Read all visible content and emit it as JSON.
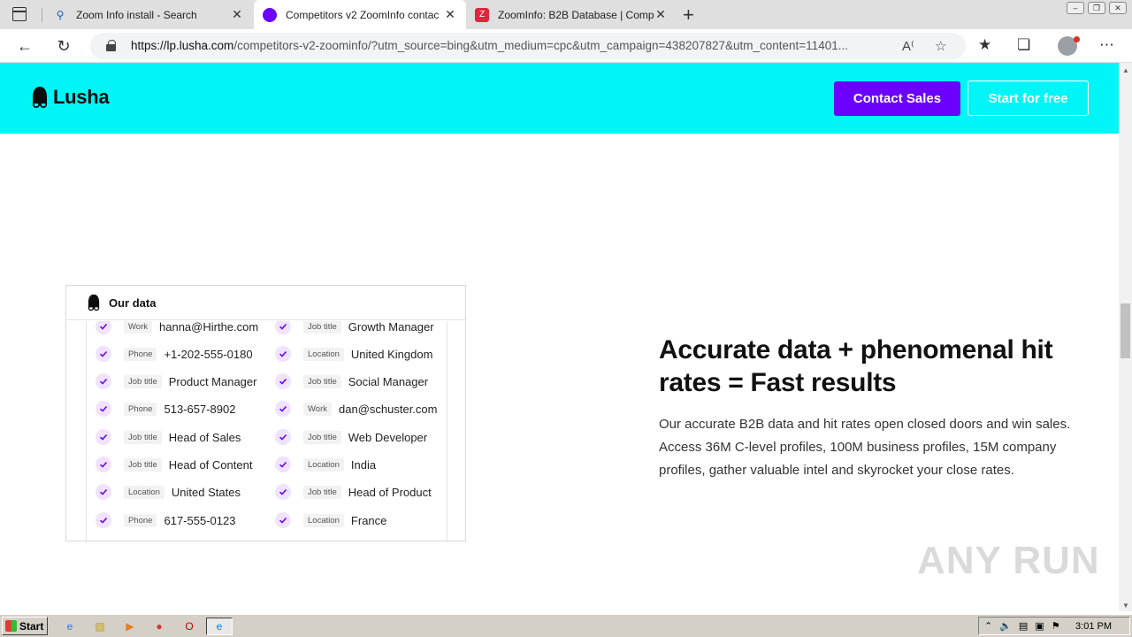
{
  "browser": {
    "tabs": [
      {
        "title": "Zoom Info install - Search",
        "icon": "search-icon",
        "active": false
      },
      {
        "title": "Competitors v2 ZoomInfo contac",
        "icon": "lusha-icon",
        "active": true
      },
      {
        "title": "ZoomInfo: B2B Database | Comp",
        "icon": "zoominfo-icon",
        "active": false
      }
    ],
    "url_domain": "https://lp.lusha.com",
    "url_rest": "/competitors-v2-zoominfo/?utm_source=bing&utm_medium=cpc&utm_campaign=438207827&utm_content=11401..."
  },
  "site": {
    "logo_text": "Lusha",
    "contact_sales": "Contact Sales",
    "start_free": "Start for free",
    "header_color": "#00f6f6",
    "accent_color": "#6c00ff"
  },
  "data_card": {
    "title": "Our data",
    "left_rows": [
      {
        "tag": "Work",
        "value": "hanna@Hirthe.com"
      },
      {
        "tag": "Phone",
        "value": "+1-202-555-0180"
      },
      {
        "tag": "Job title",
        "value": "Product Manager"
      },
      {
        "tag": "Phone",
        "value": "513-657-8902"
      },
      {
        "tag": "Job title",
        "value": "Head of Sales"
      },
      {
        "tag": "Job title",
        "value": "Head of Content"
      },
      {
        "tag": "Location",
        "value": "United States"
      },
      {
        "tag": "Phone",
        "value": "617-555-0123"
      }
    ],
    "right_rows": [
      {
        "tag": "Job title",
        "value": "Growth Manager"
      },
      {
        "tag": "Location",
        "value": "United Kingdom"
      },
      {
        "tag": "Job title",
        "value": "Social Manager"
      },
      {
        "tag": "Work",
        "value": "dan@schuster.com"
      },
      {
        "tag": "Job title",
        "value": "Web Developer"
      },
      {
        "tag": "Location",
        "value": "India"
      },
      {
        "tag": "Job title",
        "value": "Head of Product"
      },
      {
        "tag": "Location",
        "value": "France"
      }
    ]
  },
  "content": {
    "headline": "Accurate data + phenomenal hit rates = Fast results",
    "description": "Our accurate B2B data and hit rates open closed doors and win sales. Access 36M C-level profiles, 100M business profiles, 15M company profiles, gather valuable intel and skyrocket your close rates."
  },
  "watermark": "ANY RUN",
  "taskbar": {
    "start_label": "Start",
    "clock": "3:01 PM"
  }
}
